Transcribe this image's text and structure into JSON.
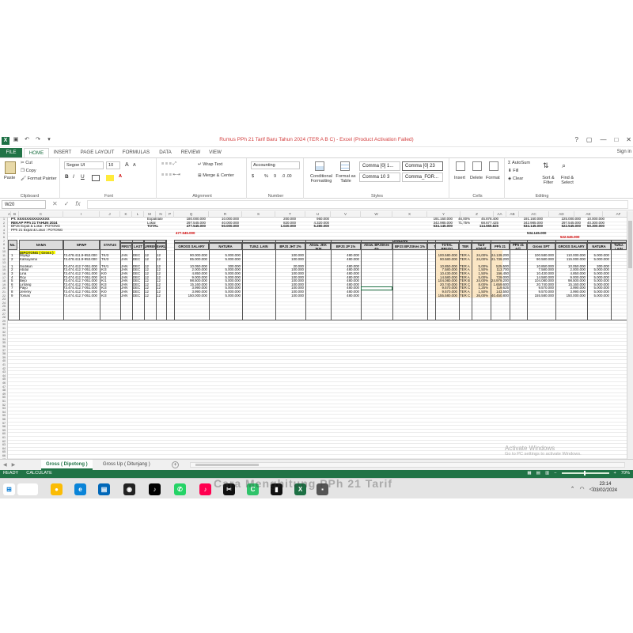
{
  "window": {
    "title": "Rumus PPh 21 Tarif Baru Tahun 2024 (TER A B C) - Excel (Product Activation Failed)",
    "controls": [
      "?",
      "▢",
      "—",
      "□",
      "✕"
    ],
    "signin": "Sign in"
  },
  "tabs": [
    "FILE",
    "HOME",
    "INSERT",
    "PAGE LAYOUT",
    "FORMULAS",
    "DATA",
    "REVIEW",
    "VIEW"
  ],
  "ribbon": {
    "clipboard": {
      "paste": "Paste",
      "cut": "Cut",
      "copy": "Copy",
      "format_painter": "Format Painter",
      "label": "Clipboard"
    },
    "font": {
      "name": "Segoe UI",
      "size": "10",
      "label": "Font",
      "grow": "A",
      "shrink": "A",
      "bold": "B",
      "italic": "I",
      "underline": "U"
    },
    "alignment": {
      "wrap": "Wrap Text",
      "merge": "Merge & Center",
      "label": "Alignment"
    },
    "number": {
      "format": "Accounting",
      "currency": "$",
      "percent": "%",
      "comma": "9",
      "label": "Number"
    },
    "styles": {
      "conditional": "Conditional Formatting",
      "format_table": "Format as Table",
      "cell_styles": [
        "Comma [0] 1...",
        "Comma [0] 23",
        "Comma 10 3",
        "Comma_FOR..."
      ],
      "label": "Styles"
    },
    "cells": {
      "insert": "Insert",
      "delete": "Delete",
      "format": "Format",
      "label": "Cells"
    },
    "editing": {
      "autosum": "AutoSum",
      "fill": "Fill",
      "clear": "Clear",
      "sort": "Sort & Filter",
      "find": "Find & Select",
      "label": "Editing"
    }
  },
  "formula_bar": {
    "name_box": "W20",
    "cancel": "✕",
    "enter": "✓",
    "fx": "fx",
    "value": ""
  },
  "sheet": {
    "columns": [
      "A",
      "B",
      "C",
      "I",
      "J",
      "K",
      "L",
      "M",
      "N",
      "P",
      "Q",
      "R",
      "S",
      "T",
      "U",
      "V",
      "W",
      "X",
      "Y",
      "Z",
      "AA",
      "AB",
      "AC",
      "AD",
      "AE",
      "AF",
      "AG",
      "AH"
    ],
    "header": {
      "company": "PT. XXXXXXXXXXXXXX",
      "report": "REKAP PPh 21 TAHUN 2024",
      "note1": "BPJS Expat & Lokal : POTONG",
      "note2": "PPh 21 Expat & Lokal : POTONG"
    },
    "summary": {
      "labels": [
        "Expatriate",
        "Lokal",
        "TOTAL"
      ],
      "gross": [
        "180.000.000",
        "297.545.000",
        "477.545.000"
      ],
      "natura": [
        "10.000.000",
        "40.000.000",
        "50.000.000"
      ],
      "allow": [
        "200.000",
        "820.000",
        "1.020.000"
      ],
      "bpjs": [
        "960.000",
        "4.320.000",
        "5.280.000"
      ],
      "bruto": [
        "191.160.000",
        "342.985.000",
        "534.145.000"
      ],
      "pct": [
        "46,00%",
        "71,75%"
      ],
      "pph": [
        "45.878.400",
        "68.677.425",
        "114.555.825"
      ],
      "gsp": [
        "191.160.000",
        "342.985.000",
        "534.145.000"
      ],
      "ag": [
        "225.000.000",
        "297.545.000",
        "522.545.000"
      ],
      "ah": [
        "10.000.000",
        "40.300.000",
        "50.300.000"
      ],
      "red_total": "477.545.000",
      "gsp_total2": "534.145.000",
      "red_total2": "522.545.000"
    },
    "table_headers": {
      "no": "No.",
      "nama": "NAMA",
      "npwp": "NPWP",
      "status": "STATUS",
      "work_period": "WORK PERIOD",
      "income_period": "INCOME PERIOD",
      "first": "FIRST",
      "last": "LAST",
      "current": "CURRENT",
      "yearly": "YEARLY",
      "month": "JANUARI",
      "gross": "GROSS SALARY",
      "natura": "NATURA",
      "tunj": "TUNJ. LAIN",
      "bpjs_jht": "BPJS JHT 2%",
      "allow_jkk": "Allow. JKK JKM",
      "bpjs_jp": "BPJS JP 1%",
      "allow_bpjks": "Allow. BPJSKes 4%",
      "bpjs_kes": "BPJS BPJSKes 1%",
      "thr": "THR/BONUS",
      "pph21": "PPh 21",
      "total_bruto": "TOTAL BRUTO",
      "ter": "TER",
      "tarif": "Tarif Efektif",
      "pph21b": "PPh 21",
      "pph_adj": "PPh 21 Adj.",
      "gross_spt": "Gross SPT",
      "gross2": "GROSS SALARY",
      "natura2": "NATURA",
      "tunj2": "TUNJ. LAIN"
    },
    "section_label": "DIPOTONG ( Gross )",
    "rows": [
      {
        "row": "11",
        "no": "1",
        "nama": "Miyagi",
        "npwp": "73.478.411.9-953.000",
        "status": "TK/3",
        "first": "JAN",
        "last": "DEC",
        "cur": "12",
        "yr": "12",
        "gross": "90.000.000",
        "natura": "5.000.000",
        "allow": "100.000",
        "bpjs": "480.000",
        "bruto": "100.580.000",
        "ter": "TER A",
        "tarif": "24,00%",
        "pph": "24.139.200",
        "gsp": "100.580.000",
        "ag": "110.000.000",
        "ah": "5.000.000"
      },
      {
        "row": "12",
        "no": "2",
        "nama": "Katsuyama",
        "npwp": "73.478.411.9-953.000",
        "status": "TK/3",
        "first": "JAN",
        "last": "DEC",
        "cur": "12",
        "yr": "12",
        "gross": "85.000.000",
        "natura": "5.000.000",
        "allow": "100.000",
        "bpjs": "480.000",
        "bruto": "90.580.000",
        "ter": "TER A",
        "tarif": "24,00%",
        "pph": "21.739.200",
        "gsp": "90.580.000",
        "ag": "115.000.000",
        "ah": "5.000.000"
      },
      {
        "row": "14",
        "no": "1",
        "nama": "Sodikun",
        "npwp": "73.474.412.7-051.000",
        "status": "TK/1",
        "first": "JAN",
        "last": "DEC",
        "cur": "12",
        "yr": "12",
        "gross": "10.050.000",
        "natura": "300.000",
        "allow": "20.000",
        "bpjs": "480.000",
        "bruto": "10.850.000",
        "ter": "TER A",
        "tarif": "5,00%",
        "pph": "525.500",
        "gsp": "10.850.000",
        "ag": "10.050.000",
        "ah": "300.000"
      },
      {
        "row": "15",
        "no": "2",
        "nama": "Abdul",
        "npwp": "73.474.412.7-051.000",
        "status": "K/3",
        "first": "JAN",
        "last": "DEC",
        "cur": "12",
        "yr": "12",
        "gross": "2.000.000",
        "natura": "5.000.000",
        "allow": "100.000",
        "bpjs": "480.000",
        "bruto": "7.580.000",
        "ter": "TER A",
        "tarif": "1,50%",
        "pph": "113.700",
        "gsp": "7.580.000",
        "ag": "2.000.000",
        "ah": "5.000.000"
      },
      {
        "row": "16",
        "no": "3",
        "nama": "Lina",
        "npwp": "73.474.412.7-051.000",
        "status": "K/0",
        "first": "JAN",
        "last": "DEC",
        "cur": "12",
        "yr": "12",
        "gross": "4.850.000",
        "natura": "5.000.000",
        "allow": "100.000",
        "bpjs": "480.000",
        "bruto": "10.430.000",
        "ter": "TER A",
        "tarif": "1,50%",
        "pph": "156.450",
        "gsp": "10.430.000",
        "ag": "4.850.000",
        "ah": "5.000.000"
      },
      {
        "row": "17",
        "no": "4",
        "nama": "Roy",
        "npwp": "73.474.412.7-051.000",
        "status": "K/1",
        "first": "JAN",
        "last": "DEC",
        "cur": "12",
        "yr": "12",
        "gross": "9.000.000",
        "natura": "5.000.000",
        "allow": "100.000",
        "bpjs": "480.000",
        "bruto": "14.580.000",
        "ter": "TER A",
        "tarif": "5,00%",
        "pph": "729.000",
        "gsp": "14.580.000",
        "ag": "9.000.000",
        "ah": "5.000.000"
      },
      {
        "row": "18",
        "no": "5",
        "nama": "Bejo",
        "npwp": "73.474.412.7-051.000",
        "status": "K/1",
        "first": "JAN",
        "last": "DEC",
        "cur": "12",
        "yr": "12",
        "gross": "98.500.000",
        "natura": "5.000.000",
        "allow": "100.000",
        "bpjs": "480.000",
        "bruto": "104.080.000",
        "ter": "TER B",
        "tarif": "24,00%",
        "pph": "24.979.200",
        "gsp": "104.080.000",
        "ag": "98.500.000",
        "ah": "5.000.000"
      },
      {
        "row": "19",
        "no": "6",
        "nama": "Lintang",
        "npwp": "73.474.412.7-051.000",
        "status": "K/3",
        "first": "JAN",
        "last": "DEC",
        "cur": "12",
        "yr": "12",
        "gross": "15.160.000",
        "natura": "5.000.000",
        "allow": "100.000",
        "bpjs": "480.000",
        "bruto": "20.740.000",
        "ter": "TER C",
        "tarif": "8,00%",
        "pph": "1.659.600",
        "gsp": "20.740.000",
        "ag": "15.160.000",
        "ah": "5.000.000"
      },
      {
        "row": "20",
        "no": "7",
        "nama": "Paijo",
        "npwp": "73.474.412.7-051.000",
        "status": "K/3",
        "first": "JAN",
        "last": "DEC",
        "cur": "12",
        "yr": "12",
        "gross": "3.990.000",
        "natura": "5.000.000",
        "allow": "100.000",
        "bpjs": "480.000",
        "bruto": "9.570.000",
        "ter": "TER C",
        "tarif": "1,25%",
        "pph": "119.625",
        "gsp": "9.570.000",
        "ag": "3.990.000",
        "ah": "5.000.000"
      },
      {
        "row": "21",
        "no": "8",
        "nama": "Jeremy",
        "npwp": "73.474.412.7-051.000",
        "status": "K/0",
        "first": "JAN",
        "last": "DEC",
        "cur": "12",
        "yr": "12",
        "gross": "3.990.000",
        "natura": "5.000.000",
        "allow": "100.000",
        "bpjs": "480.000",
        "bruto": "9.570.000",
        "ter": "TER A",
        "tarif": "1,50%",
        "pph": "143.550",
        "gsp": "9.570.000",
        "ag": "3.990.000",
        "ah": "5.000.000"
      },
      {
        "row": "22",
        "no": "9",
        "nama": "Tomas",
        "npwp": "73.474.412.7-051.000",
        "status": "K/3",
        "first": "JAN",
        "last": "DEC",
        "cur": "12",
        "yr": "12",
        "gross": "150.000.000",
        "natura": "5.000.000",
        "allow": "100.000",
        "bpjs": "480.000",
        "bruto": "155.580.000",
        "ter": "TER C",
        "tarif": "26,00%",
        "pph": "40.450.800",
        "gsp": "155.580.000",
        "ag": "150.000.000",
        "ah": "5.000.000"
      }
    ],
    "row_numbers": [
      "1",
      "2",
      "3",
      "4",
      "5",
      "6",
      "7",
      "8",
      "9",
      "10",
      "11",
      "12",
      "13",
      "14",
      "15",
      "16",
      "17",
      "18",
      "19",
      "20",
      "21",
      "22",
      "23",
      "24",
      "25",
      "26",
      "27",
      "28",
      "29",
      "30",
      "31",
      "32",
      "33",
      "34",
      "35",
      "36",
      "37",
      "38",
      "39",
      "40",
      "41",
      "42",
      "43",
      "44",
      "45",
      "46",
      "47",
      "48",
      "49",
      "50",
      "51",
      "52",
      "53",
      "54",
      "55",
      "56",
      "57",
      "58",
      "59",
      "60",
      "61",
      "62",
      "63",
      "64",
      "65",
      "66",
      "67",
      "68",
      "69",
      "70",
      "71",
      "72",
      "73"
    ]
  },
  "sheet_tabs": [
    "Gross ( Dipotong )",
    "Gross Up ( Ditunjang )"
  ],
  "status": {
    "ready": "READY",
    "calc": "CALCULATE",
    "zoom": "70%"
  },
  "watermark": {
    "line1": "Activate Windows",
    "line2": "Go to PC settings to activate Windows."
  },
  "taskbar": {
    "overlay": "Cara Menghitung PPh 21 Tarif",
    "time": "23:14",
    "date": "03/02/2024"
  },
  "colors": {
    "excel_green": "#217346",
    "title_red": "#d34040",
    "peach": "#fbe6c4",
    "header_grey": "#dbdbdb"
  }
}
